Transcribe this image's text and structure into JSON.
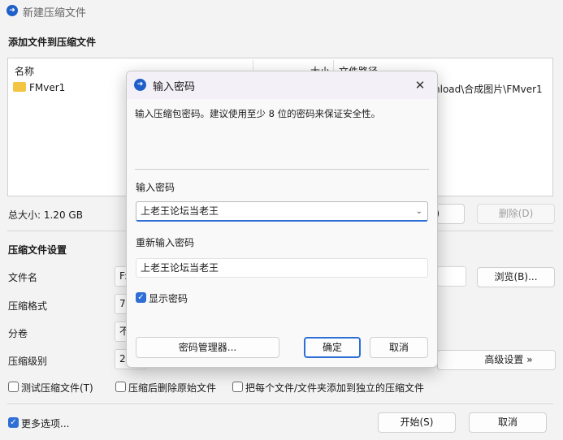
{
  "window": {
    "title": "新建压缩文件"
  },
  "add_section": {
    "title": "添加文件到压缩文件"
  },
  "file_table": {
    "columns": [
      "名称",
      "大小",
      "文件路径"
    ],
    "rows": [
      {
        "name": "FMver1",
        "path": "nload\\合成图片\\FMver1"
      }
    ]
  },
  "total_size": "总大小: 1.20 GB",
  "buttons": {
    "add_partial": ")",
    "delete": "删除(D)",
    "browse": "浏览(B)...",
    "advanced": "高级设置 »",
    "start": "开始(S)",
    "cancel": "取消"
  },
  "settings": {
    "title": "压缩文件设置",
    "filename_label": "文件名",
    "filename_value": "F:\\",
    "format_label": "压缩格式",
    "format_value": "7Z",
    "volume_label": "分卷",
    "volume_value": "不",
    "level_label": "压缩级别",
    "level_value": "2-"
  },
  "options": {
    "test": "测试压缩文件(T)",
    "delete_after": "压缩后删除原始文件",
    "separate": "把每个文件/文件夹添加到独立的压缩文件",
    "more": "更多选项..."
  },
  "dialog": {
    "title": "输入密码",
    "description": "输入压缩包密码。建议使用至少 8 位的密码来保证安全性。",
    "password_label": "输入密码",
    "password_value": "上老王论坛当老王",
    "reenter_label": "重新输入密码",
    "reenter_value": "上老王论坛当老王",
    "show_password": "显示密码",
    "manager_button": "密码管理器...",
    "ok_button": "确定",
    "cancel_button": "取消"
  },
  "colors": {
    "accent": "#2e6fd6",
    "dialog_bg": "#f9f9f9"
  }
}
